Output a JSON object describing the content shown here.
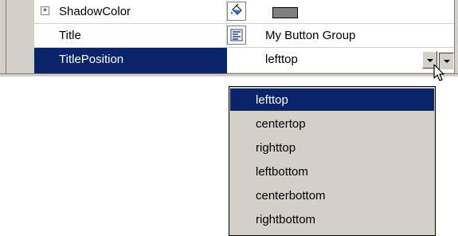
{
  "properties": [
    {
      "name": "ShadowColor",
      "value": "",
      "expandable": true,
      "expander_glyph": "+",
      "editor_icon": "paint-bucket-icon",
      "swatch_color": "#808080"
    },
    {
      "name": "Title",
      "value": "My Button Group",
      "expandable": false,
      "editor_icon": "text-align-icon"
    },
    {
      "name": "TitlePosition",
      "value": "lefttop",
      "selected": true
    }
  ],
  "dropdown": {
    "open": true,
    "selected": "lefttop",
    "options": [
      "lefttop",
      "centertop",
      "righttop",
      "leftbottom",
      "centerbottom",
      "rightbottom"
    ]
  },
  "colors": {
    "selection": "#0a246a",
    "chrome": "#d4d0c8",
    "swatch": "#808080"
  }
}
